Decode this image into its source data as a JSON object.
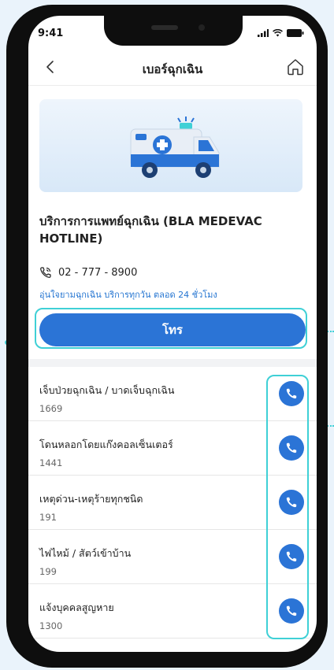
{
  "status": {
    "time": "9:41"
  },
  "nav": {
    "title": "เบอร์ฉุกเฉิน"
  },
  "service": {
    "title": "บริการการแพทย์ฉุกเฉิน  (BLA MEDEVAC HOTLINE)",
    "phone": "02 - 777 - 8900",
    "description": "อุ่นใจยามฉุกเฉิน บริการทุกวัน ตลอด 24 ชั่วโมง",
    "call_label": "โทร"
  },
  "contacts": [
    {
      "name": "เจ็บป่วยฉุกเฉิน / บาดเจ็บฉุกเฉิน",
      "number": "1669"
    },
    {
      "name": "โดนหลอกโดยแก๊งคอลเซ็นเตอร์",
      "number": "1441"
    },
    {
      "name": "เหตุด่วน-เหตุร้ายทุกชนิด",
      "number": "191"
    },
    {
      "name": "ไฟไหม้ / สัตว์เข้าบ้าน",
      "number": "199"
    },
    {
      "name": "แจ้งบุคคลสูญหาย",
      "number": "1300"
    }
  ],
  "colors": {
    "accent": "#2b74d6",
    "highlight": "#3fd0d6",
    "link": "#2575d1"
  },
  "icons": [
    "signal-icon",
    "wifi-icon",
    "battery-icon",
    "back-icon",
    "home-icon",
    "ambulance-illustration",
    "phone-call-icon"
  ]
}
